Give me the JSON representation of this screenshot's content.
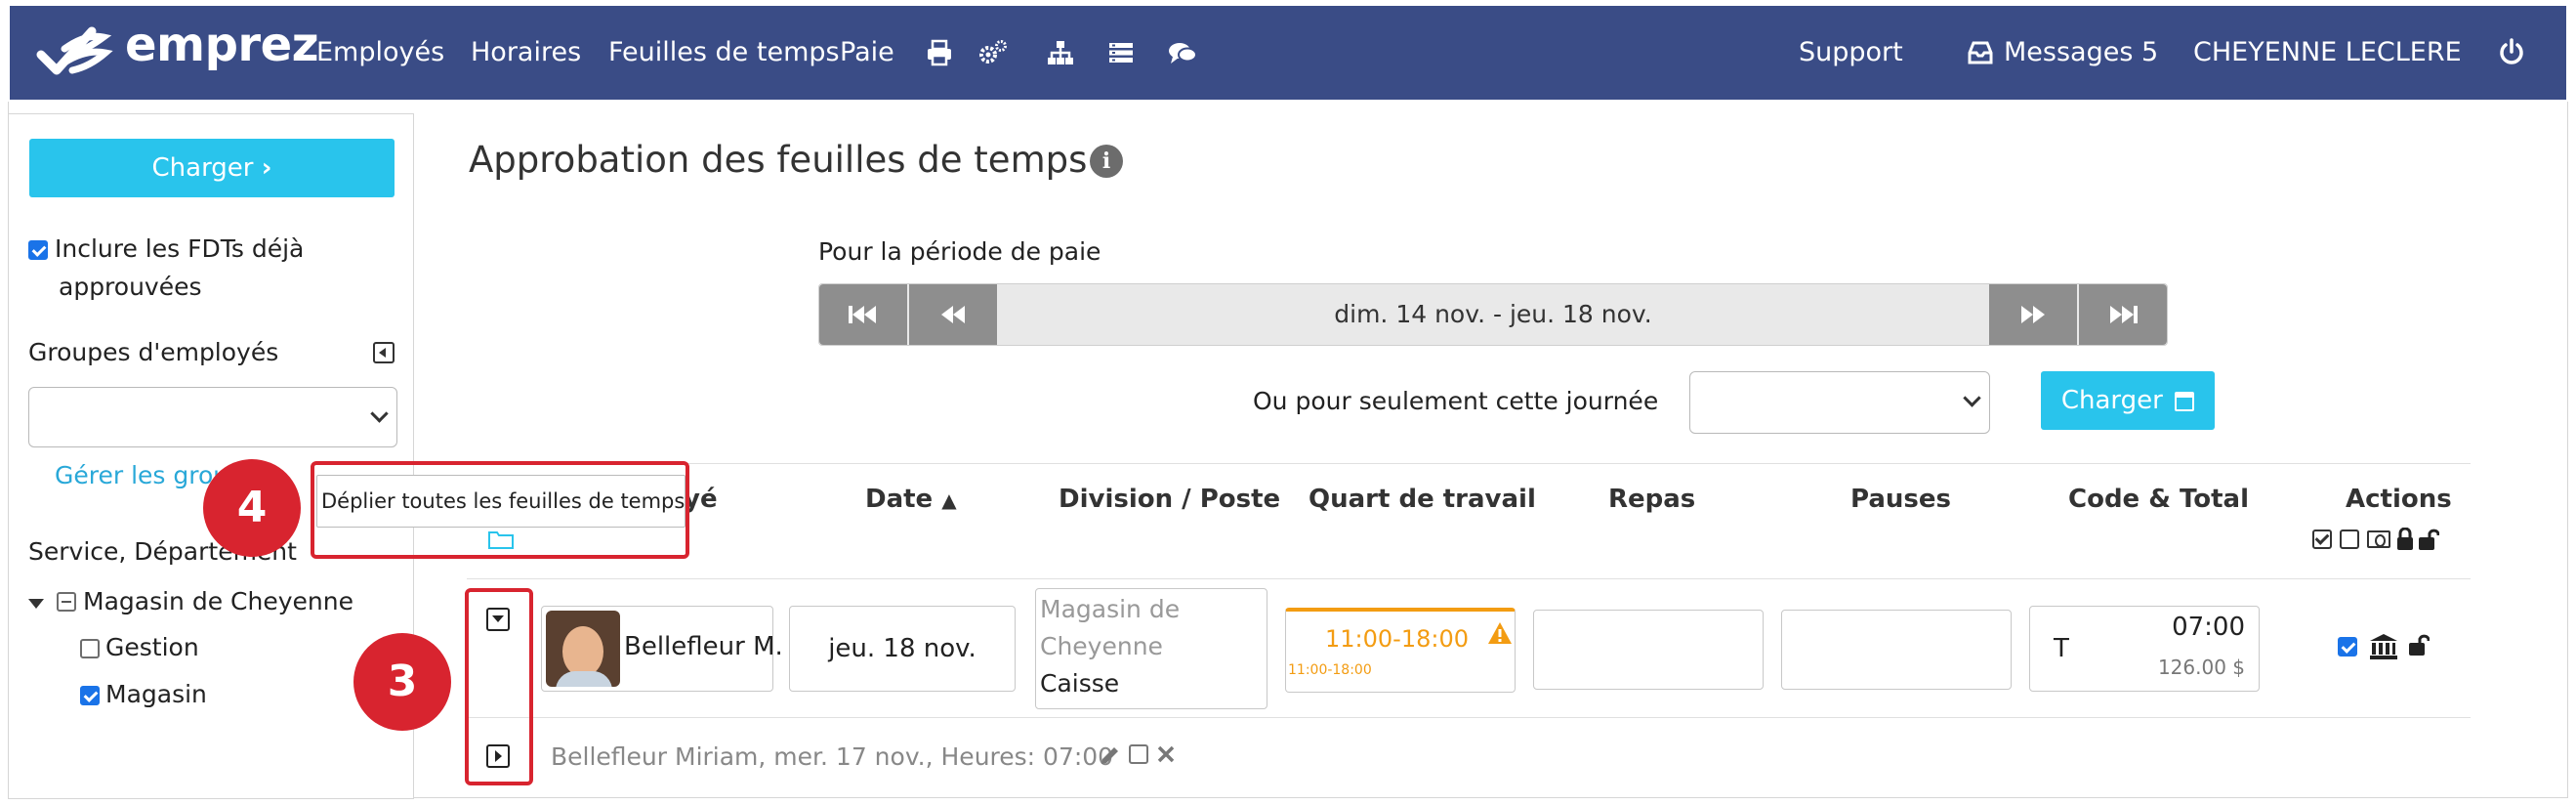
{
  "nav": {
    "logo": "emprez",
    "items": [
      "Employés",
      "Horaires",
      "Feuilles de temps",
      "Paie"
    ],
    "icons": [
      "print-icon",
      "cogs-icon",
      "sitemap-icon",
      "list-icon",
      "comments-icon"
    ],
    "support": "Support",
    "messages": "Messages 5",
    "user": "CHEYENNE LECLERE",
    "power_icon": "power-icon",
    "colors": {
      "navbar": "#3a4c86",
      "accent": "#29c4ec",
      "callout": "#d8242f",
      "warning": "#f39c12"
    }
  },
  "sidebar": {
    "load_button": "Charger",
    "include_approved": "Inclure les FDTs déjà approuvées",
    "include_approved_line1": "Inclure les FDTs déjà",
    "include_approved_line2": "approuvées",
    "employee_groups": "Groupes d'employés",
    "manage_groups": "Gérer les grou",
    "department_label": "Service, Département",
    "tree": {
      "root": "Magasin de Cheyenne",
      "children": [
        {
          "label": "Gestion",
          "checked": false
        },
        {
          "label": "Magasin",
          "checked": true
        }
      ]
    }
  },
  "main": {
    "title": "Approbation des feuilles de temps",
    "pay_period_label": "Pour la période de paie",
    "period_range": "dim. 14 nov. - jeu. 18 nov.",
    "day_label": "Ou pour seulement cette journée",
    "day_select_value": "",
    "load_button": "Charger",
    "columns": {
      "employee_tail": "yé",
      "date": "Date",
      "division": "Division / Poste",
      "shift": "Quart de travail",
      "meals": "Repas",
      "breaks": "Pauses",
      "code_total": "Code & Total",
      "actions": "Actions"
    },
    "tooltip": "Déplier toutes les feuilles de temps",
    "row": {
      "employee": "Bellefleur M.",
      "date": "jeu. 18 nov.",
      "division_line1": "Magasin de",
      "division_line2": "Cheyenne",
      "position": "Caisse",
      "shift": "11:00-18:00",
      "shift_small": "11:00-18:00",
      "code": "T",
      "total_time": "07:00",
      "total_amount": "126.00 $"
    },
    "sub_row": "Bellefleur Miriam, mer. 17 nov., Heures: 07:00"
  },
  "callouts": {
    "three": "3",
    "four": "4"
  }
}
